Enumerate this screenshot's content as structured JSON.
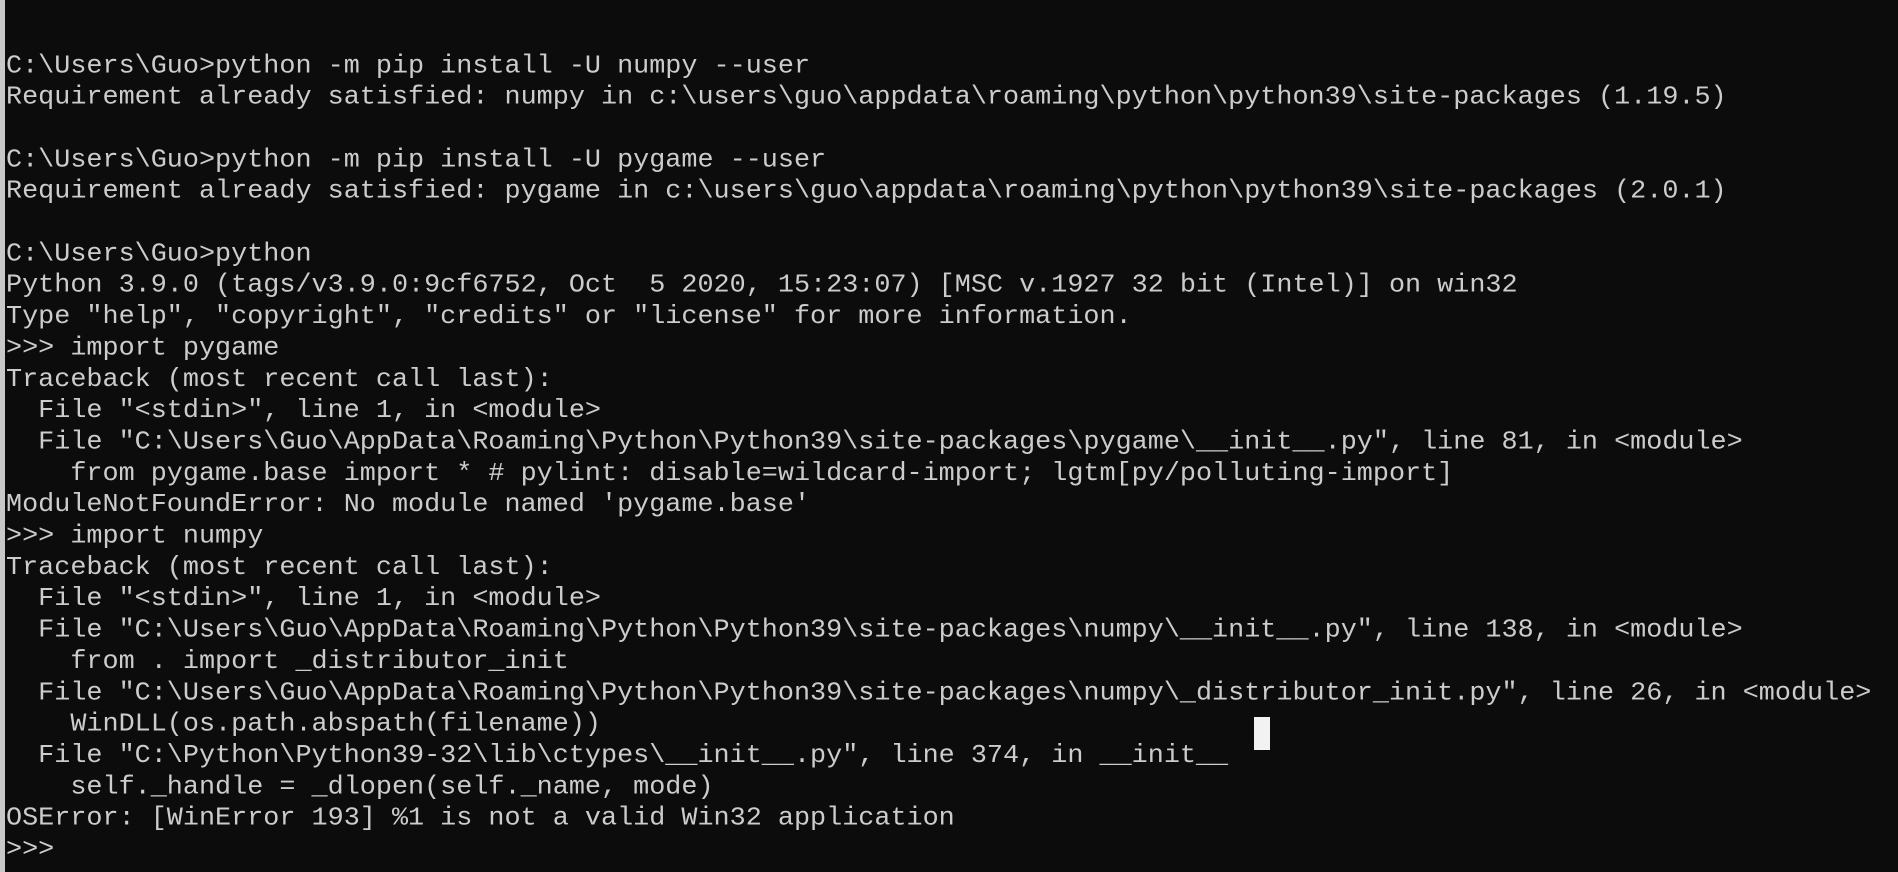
{
  "window": {
    "type": "Windows Command Prompt",
    "colors": {
      "background": "#0c0c0c",
      "foreground": "#cccccc",
      "cursor": "#f2f2f2",
      "border": "#c8c8c8"
    }
  },
  "console": {
    "lines": [
      "",
      "C:\\Users\\Guo>python -m pip install -U numpy --user",
      "Requirement already satisfied: numpy in c:\\users\\guo\\appdata\\roaming\\python\\python39\\site-packages (1.19.5)",
      "",
      "C:\\Users\\Guo>python -m pip install -U pygame --user",
      "Requirement already satisfied: pygame in c:\\users\\guo\\appdata\\roaming\\python\\python39\\site-packages (2.0.1)",
      "",
      "C:\\Users\\Guo>python",
      "Python 3.9.0 (tags/v3.9.0:9cf6752, Oct  5 2020, 15:23:07) [MSC v.1927 32 bit (Intel)] on win32",
      "Type \"help\", \"copyright\", \"credits\" or \"license\" for more information.",
      ">>> import pygame",
      "Traceback (most recent call last):",
      "  File \"<stdin>\", line 1, in <module>",
      "  File \"C:\\Users\\Guo\\AppData\\Roaming\\Python\\Python39\\site-packages\\pygame\\__init__.py\", line 81, in <module>",
      "    from pygame.base import * # pylint: disable=wildcard-import; lgtm[py/polluting-import]",
      "ModuleNotFoundError: No module named 'pygame.base'",
      ">>> import numpy",
      "Traceback (most recent call last):",
      "  File \"<stdin>\", line 1, in <module>",
      "  File \"C:\\Users\\Guo\\AppData\\Roaming\\Python\\Python39\\site-packages\\numpy\\__init__.py\", line 138, in <module>",
      "    from . import _distributor_init",
      "  File \"C:\\Users\\Guo\\AppData\\Roaming\\Python\\Python39\\site-packages\\numpy\\_distributor_init.py\", line 26, in <module>",
      "    WinDLL(os.path.abspath(filename))",
      "  File \"C:\\Python\\Python39-32\\lib\\ctypes\\__init__.py\", line 374, in __init__",
      "    self._handle = _dlopen(self._name, mode)",
      "OSError: [WinError 193] %1 is not a valid Win32 application",
      ">>>"
    ]
  }
}
